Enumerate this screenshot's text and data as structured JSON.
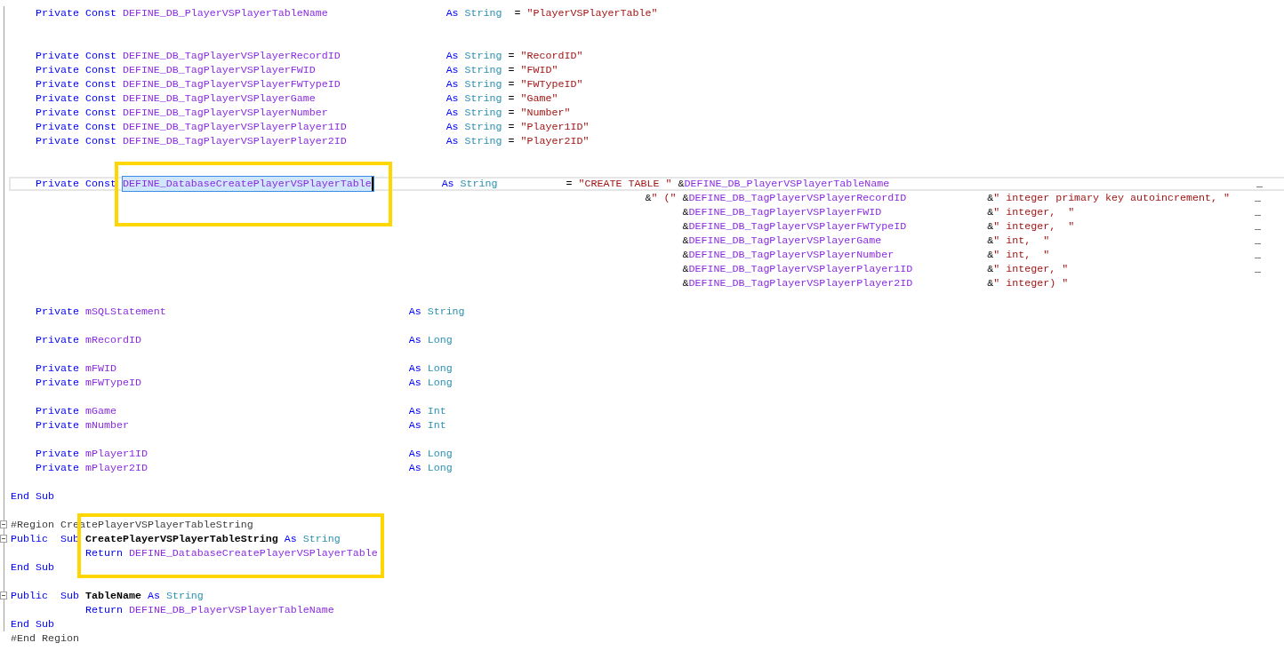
{
  "lines": [
    {
      "kind": "const_name",
      "cells": [
        [
          {
            "kind": "keyword",
            "text": "Private"
          }
        ],
        [
          {
            "kind": "keyword",
            "text": "Const"
          }
        ],
        [
          {
            "kind": "ident",
            "text": "DEFINE_DB_PlayerVSPlayerTableName"
          }
        ],
        [
          {
            "kind": "keyword",
            "text": "As"
          }
        ],
        [
          {
            "kind": "type",
            "text": "String"
          }
        ],
        [
          {
            "kind": "plain",
            "text": "="
          }
        ],
        [
          {
            "kind": "string",
            "text": "\"PlayerVSPlayerTable\""
          }
        ]
      ]
    },
    {
      "kind": "blank"
    },
    {
      "kind": "blank"
    },
    {
      "kind": "const",
      "cells": [
        [
          {
            "kind": "keyword",
            "text": "Private"
          }
        ],
        [
          {
            "kind": "keyword",
            "text": "Const"
          }
        ],
        [
          {
            "kind": "ident",
            "text": "DEFINE_DB_TagPlayerVSPlayerRecordID"
          }
        ],
        [
          {
            "kind": "keyword",
            "text": "As"
          }
        ],
        [
          {
            "kind": "type",
            "text": "String"
          }
        ],
        [
          {
            "kind": "plain",
            "text": "="
          }
        ],
        [
          {
            "kind": "string",
            "text": "\"RecordID\""
          }
        ]
      ]
    },
    {
      "kind": "const",
      "cells": [
        [
          {
            "kind": "keyword",
            "text": "Private"
          }
        ],
        [
          {
            "kind": "keyword",
            "text": "Const"
          }
        ],
        [
          {
            "kind": "ident",
            "text": "DEFINE_DB_TagPlayerVSPlayerFWID"
          }
        ],
        [
          {
            "kind": "keyword",
            "text": "As"
          }
        ],
        [
          {
            "kind": "type",
            "text": "String"
          }
        ],
        [
          {
            "kind": "plain",
            "text": "="
          }
        ],
        [
          {
            "kind": "string",
            "text": "\"FWID\""
          }
        ]
      ]
    },
    {
      "kind": "const",
      "cells": [
        [
          {
            "kind": "keyword",
            "text": "Private"
          }
        ],
        [
          {
            "kind": "keyword",
            "text": "Const"
          }
        ],
        [
          {
            "kind": "ident",
            "text": "DEFINE_DB_TagPlayerVSPlayerFWTypeID"
          }
        ],
        [
          {
            "kind": "keyword",
            "text": "As"
          }
        ],
        [
          {
            "kind": "type",
            "text": "String"
          }
        ],
        [
          {
            "kind": "plain",
            "text": "="
          }
        ],
        [
          {
            "kind": "string",
            "text": "\"FWTypeID\""
          }
        ]
      ]
    },
    {
      "kind": "const",
      "cells": [
        [
          {
            "kind": "keyword",
            "text": "Private"
          }
        ],
        [
          {
            "kind": "keyword",
            "text": "Const"
          }
        ],
        [
          {
            "kind": "ident",
            "text": "DEFINE_DB_TagPlayerVSPlayerGame"
          }
        ],
        [
          {
            "kind": "keyword",
            "text": "As"
          }
        ],
        [
          {
            "kind": "type",
            "text": "String"
          }
        ],
        [
          {
            "kind": "plain",
            "text": "="
          }
        ],
        [
          {
            "kind": "string",
            "text": "\"Game\""
          }
        ]
      ]
    },
    {
      "kind": "const",
      "cells": [
        [
          {
            "kind": "keyword",
            "text": "Private"
          }
        ],
        [
          {
            "kind": "keyword",
            "text": "Const"
          }
        ],
        [
          {
            "kind": "ident",
            "text": "DEFINE_DB_TagPlayerVSPlayerNumber"
          }
        ],
        [
          {
            "kind": "keyword",
            "text": "As"
          }
        ],
        [
          {
            "kind": "type",
            "text": "String"
          }
        ],
        [
          {
            "kind": "plain",
            "text": "="
          }
        ],
        [
          {
            "kind": "string",
            "text": "\"Number\""
          }
        ]
      ]
    },
    {
      "kind": "const",
      "cells": [
        [
          {
            "kind": "keyword",
            "text": "Private"
          }
        ],
        [
          {
            "kind": "keyword",
            "text": "Const"
          }
        ],
        [
          {
            "kind": "ident",
            "text": "DEFINE_DB_TagPlayerVSPlayerPlayer1ID"
          }
        ],
        [
          {
            "kind": "keyword",
            "text": "As"
          }
        ],
        [
          {
            "kind": "type",
            "text": "String"
          }
        ],
        [
          {
            "kind": "plain",
            "text": "="
          }
        ],
        [
          {
            "kind": "string",
            "text": "\"Player1ID\""
          }
        ]
      ]
    },
    {
      "kind": "const",
      "cells": [
        [
          {
            "kind": "keyword",
            "text": "Private"
          }
        ],
        [
          {
            "kind": "keyword",
            "text": "Const"
          }
        ],
        [
          {
            "kind": "ident",
            "text": "DEFINE_DB_TagPlayerVSPlayerPlayer2ID"
          }
        ],
        [
          {
            "kind": "keyword",
            "text": "As"
          }
        ],
        [
          {
            "kind": "type",
            "text": "String"
          }
        ],
        [
          {
            "kind": "plain",
            "text": "="
          }
        ],
        [
          {
            "kind": "string",
            "text": "\"Player2ID\""
          }
        ]
      ]
    },
    {
      "kind": "blank"
    },
    {
      "kind": "blank"
    },
    {
      "kind": "const_concat_head",
      "current": true,
      "cells": [
        [
          {
            "kind": "keyword",
            "text": "Private"
          }
        ],
        [
          {
            "kind": "keyword",
            "text": "Const"
          }
        ],
        [
          {
            "kind": "ident",
            "text": "DEFINE_DatabaseCreatePlayerVSPlayerTable",
            "selected": true
          }
        ],
        [
          {
            "kind": "keyword",
            "text": "As"
          }
        ],
        [
          {
            "kind": "type",
            "text": "String"
          }
        ],
        [
          {
            "kind": "plain",
            "text": "="
          }
        ],
        [
          {
            "kind": "string",
            "text": "\"CREATE TABLE \""
          }
        ],
        [
          {
            "kind": "plain",
            "text": "&"
          },
          {
            "kind": "ident",
            "text": "DEFINE_DB_PlayerVSPlayerTableName"
          }
        ],
        [
          {
            "kind": "plain",
            "text": "_"
          }
        ]
      ]
    },
    {
      "kind": "concat_open",
      "cells": [
        [
          {
            "kind": "plain",
            "text": "&"
          },
          {
            "kind": "string",
            "text": "\" (\""
          }
        ],
        [
          {
            "kind": "plain",
            "text": "&"
          },
          {
            "kind": "ident",
            "text": "DEFINE_DB_TagPlayerVSPlayerRecordID"
          }
        ],
        [
          {
            "kind": "plain",
            "text": "&"
          },
          {
            "kind": "string",
            "text": "\" integer primary key autoincrement, \""
          }
        ],
        [
          {
            "kind": "plain",
            "text": "_"
          }
        ]
      ]
    },
    {
      "kind": "concat",
      "cells": [
        [
          {
            "kind": "plain",
            "text": "&"
          },
          {
            "kind": "ident",
            "text": "DEFINE_DB_TagPlayerVSPlayerFWID"
          }
        ],
        [
          {
            "kind": "plain",
            "text": "&"
          },
          {
            "kind": "string",
            "text": "\" integer,  \""
          }
        ],
        [
          {
            "kind": "plain",
            "text": "_"
          }
        ]
      ]
    },
    {
      "kind": "concat",
      "cells": [
        [
          {
            "kind": "plain",
            "text": "&"
          },
          {
            "kind": "ident",
            "text": "DEFINE_DB_TagPlayerVSPlayerFWTypeID"
          }
        ],
        [
          {
            "kind": "plain",
            "text": "&"
          },
          {
            "kind": "string",
            "text": "\" integer,  \""
          }
        ],
        [
          {
            "kind": "plain",
            "text": "_"
          }
        ]
      ]
    },
    {
      "kind": "concat",
      "cells": [
        [
          {
            "kind": "plain",
            "text": "&"
          },
          {
            "kind": "ident",
            "text": "DEFINE_DB_TagPlayerVSPlayerGame"
          }
        ],
        [
          {
            "kind": "plain",
            "text": "&"
          },
          {
            "kind": "string",
            "text": "\" int,  \""
          }
        ],
        [
          {
            "kind": "plain",
            "text": "_"
          }
        ]
      ]
    },
    {
      "kind": "concat",
      "cells": [
        [
          {
            "kind": "plain",
            "text": "&"
          },
          {
            "kind": "ident",
            "text": "DEFINE_DB_TagPlayerVSPlayerNumber"
          }
        ],
        [
          {
            "kind": "plain",
            "text": "&"
          },
          {
            "kind": "string",
            "text": "\" int,  \""
          }
        ],
        [
          {
            "kind": "plain",
            "text": "_"
          }
        ]
      ]
    },
    {
      "kind": "concat",
      "cells": [
        [
          {
            "kind": "plain",
            "text": "&"
          },
          {
            "kind": "ident",
            "text": "DEFINE_DB_TagPlayerVSPlayerPlayer1ID"
          }
        ],
        [
          {
            "kind": "plain",
            "text": "&"
          },
          {
            "kind": "string",
            "text": "\" integer, \""
          }
        ],
        [
          {
            "kind": "plain",
            "text": "_"
          }
        ]
      ]
    },
    {
      "kind": "concat",
      "cells": [
        [
          {
            "kind": "plain",
            "text": "&"
          },
          {
            "kind": "ident",
            "text": "DEFINE_DB_TagPlayerVSPlayerPlayer2ID"
          }
        ],
        [
          {
            "kind": "plain",
            "text": "&"
          },
          {
            "kind": "string",
            "text": "\" integer) \""
          }
        ]
      ]
    },
    {
      "kind": "blank"
    },
    {
      "kind": "field",
      "cells": [
        [
          {
            "kind": "keyword",
            "text": "Private"
          }
        ],
        [
          {
            "kind": "ident",
            "text": "mSQLStatement"
          }
        ],
        [
          {
            "kind": "keyword",
            "text": "As"
          }
        ],
        [
          {
            "kind": "type",
            "text": "String"
          }
        ]
      ]
    },
    {
      "kind": "blank"
    },
    {
      "kind": "field",
      "cells": [
        [
          {
            "kind": "keyword",
            "text": "Private"
          }
        ],
        [
          {
            "kind": "ident",
            "text": "mRecordID"
          }
        ],
        [
          {
            "kind": "keyword",
            "text": "As"
          }
        ],
        [
          {
            "kind": "type",
            "text": "Long"
          }
        ]
      ]
    },
    {
      "kind": "blank"
    },
    {
      "kind": "field",
      "cells": [
        [
          {
            "kind": "keyword",
            "text": "Private"
          }
        ],
        [
          {
            "kind": "ident",
            "text": "mFWID"
          }
        ],
        [
          {
            "kind": "keyword",
            "text": "As"
          }
        ],
        [
          {
            "kind": "type",
            "text": "Long"
          }
        ]
      ]
    },
    {
      "kind": "field",
      "cells": [
        [
          {
            "kind": "keyword",
            "text": "Private"
          }
        ],
        [
          {
            "kind": "ident",
            "text": "mFWTypeID"
          }
        ],
        [
          {
            "kind": "keyword",
            "text": "As"
          }
        ],
        [
          {
            "kind": "type",
            "text": "Long"
          }
        ]
      ]
    },
    {
      "kind": "blank"
    },
    {
      "kind": "field",
      "cells": [
        [
          {
            "kind": "keyword",
            "text": "Private"
          }
        ],
        [
          {
            "kind": "ident",
            "text": "mGame"
          }
        ],
        [
          {
            "kind": "keyword",
            "text": "As"
          }
        ],
        [
          {
            "kind": "type",
            "text": "Int"
          }
        ]
      ]
    },
    {
      "kind": "field",
      "cells": [
        [
          {
            "kind": "keyword",
            "text": "Private"
          }
        ],
        [
          {
            "kind": "ident",
            "text": "mNumber"
          }
        ],
        [
          {
            "kind": "keyword",
            "text": "As"
          }
        ],
        [
          {
            "kind": "type",
            "text": "Int"
          }
        ]
      ]
    },
    {
      "kind": "blank"
    },
    {
      "kind": "field",
      "cells": [
        [
          {
            "kind": "keyword",
            "text": "Private"
          }
        ],
        [
          {
            "kind": "ident",
            "text": "mPlayer1ID"
          }
        ],
        [
          {
            "kind": "keyword",
            "text": "As"
          }
        ],
        [
          {
            "kind": "type",
            "text": "Long"
          }
        ]
      ]
    },
    {
      "kind": "field",
      "cells": [
        [
          {
            "kind": "keyword",
            "text": "Private"
          }
        ],
        [
          {
            "kind": "ident",
            "text": "mPlayer2ID"
          }
        ],
        [
          {
            "kind": "keyword",
            "text": "As"
          }
        ],
        [
          {
            "kind": "type",
            "text": "Long"
          }
        ]
      ]
    },
    {
      "kind": "blank"
    },
    {
      "kind": "end",
      "cells": [
        [
          {
            "kind": "keyword",
            "text": "End Sub"
          }
        ]
      ]
    },
    {
      "kind": "blank"
    },
    {
      "kind": "region",
      "cells": [
        [
          {
            "kind": "directive",
            "text": "#Region"
          }
        ],
        [
          {
            "kind": "directive",
            "text": "CreatePlayerVSPlayerTableString"
          }
        ]
      ]
    },
    {
      "kind": "sub",
      "cells": [
        [
          {
            "kind": "keyword",
            "text": "Public"
          }
        ],
        [
          {
            "kind": "keyword",
            "text": "Sub"
          }
        ],
        [
          {
            "kind": "name",
            "text": "CreatePlayerVSPlayerTableString"
          }
        ],
        [
          {
            "kind": "keyword",
            "text": "As"
          }
        ],
        [
          {
            "kind": "type",
            "text": "String"
          }
        ]
      ]
    },
    {
      "kind": "body",
      "cells": [
        [
          {
            "kind": "keyword",
            "text": "Return"
          }
        ],
        [
          {
            "kind": "ident",
            "text": "DEFINE_DatabaseCreatePlayerVSPlayerTable"
          }
        ]
      ]
    },
    {
      "kind": "end",
      "cells": [
        [
          {
            "kind": "keyword",
            "text": "End Sub"
          }
        ]
      ]
    },
    {
      "kind": "blank"
    },
    {
      "kind": "sub",
      "cells": [
        [
          {
            "kind": "keyword",
            "text": "Public"
          }
        ],
        [
          {
            "kind": "keyword",
            "text": "Sub"
          }
        ],
        [
          {
            "kind": "name",
            "text": "TableName"
          }
        ],
        [
          {
            "kind": "keyword",
            "text": "As"
          }
        ],
        [
          {
            "kind": "type",
            "text": "String"
          }
        ]
      ]
    },
    {
      "kind": "body",
      "cells": [
        [
          {
            "kind": "keyword",
            "text": "Return"
          }
        ],
        [
          {
            "kind": "ident",
            "text": "DEFINE_DB_PlayerVSPlayerTableName"
          }
        ]
      ]
    },
    {
      "kind": "end",
      "cells": [
        [
          {
            "kind": "keyword",
            "text": "End Sub"
          }
        ]
      ]
    },
    {
      "kind": "end_region",
      "cells": [
        [
          {
            "kind": "directive",
            "text": "#End Region"
          }
        ]
      ]
    }
  ]
}
